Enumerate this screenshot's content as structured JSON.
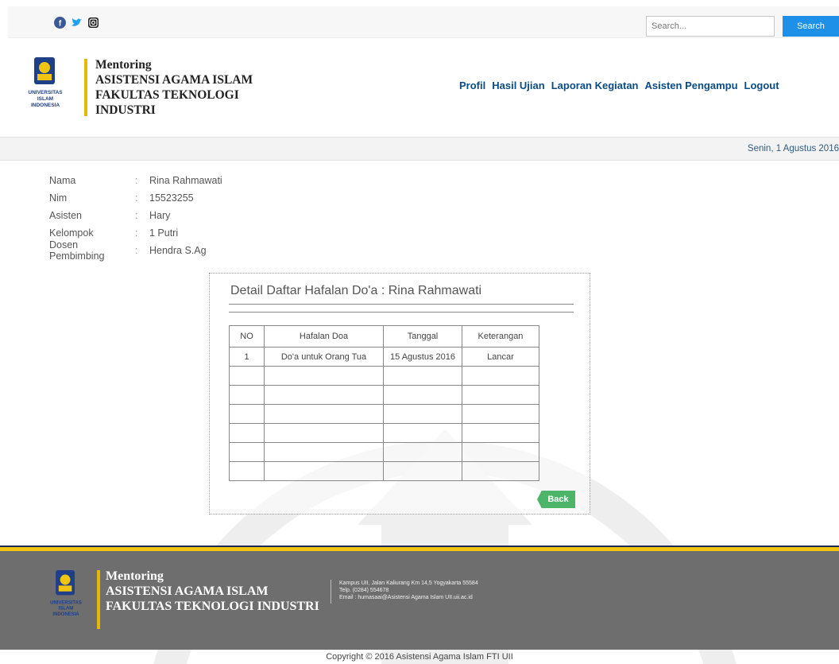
{
  "topbar": {
    "social_icons": [
      "facebook-icon",
      "twitter-icon",
      "instagram-icon"
    ],
    "search_placeholder": "Search...",
    "search_button": "Search"
  },
  "header": {
    "logo_text": [
      "UNIVERSITAS",
      "ISLAM",
      "INDONESIA"
    ],
    "title_line1": "Mentoring",
    "title_line2": "ASISTENSI AGAMA ISLAM",
    "title_line3": "FAKULTAS TEKNOLOGI",
    "title_line4": "INDUSTRI"
  },
  "nav": {
    "profil": "Profil",
    "hasil_ujian": "Hasil Ujian",
    "laporan_kegiatan": "Laporan Kegiatan",
    "asisten_pengampu": "Asisten Pengampu",
    "logout": "Logout"
  },
  "date": "Senin, 1 Agustus 2016",
  "student": {
    "nama_label": "Nama",
    "nama": "Rina Rahmawati",
    "nim_label": "Nim",
    "nim": "15523255",
    "asisten_label": "Asisten",
    "asisten": "Hary",
    "kelompok_label": "Kelompok",
    "kelompok": "1 Putri",
    "dosen_label": "Dosen Pembimbing",
    "dosen": "Hendra S.Ag",
    "separator": ":"
  },
  "panel": {
    "title": "Detail Daftar Hafalan Do'a : Rina Rahmawati",
    "headers": [
      "NO",
      "Hafalan Doa",
      "Tanggal",
      "Keterangan"
    ],
    "rows": [
      [
        "1",
        "Do'a untuk Orang Tua",
        "15 Agustus 2016",
        "Lancar"
      ],
      [
        "",
        "",
        "",
        ""
      ],
      [
        "",
        "",
        "",
        ""
      ],
      [
        "",
        "",
        "",
        ""
      ],
      [
        "",
        "",
        "",
        ""
      ],
      [
        "",
        "",
        "",
        ""
      ],
      [
        "",
        "",
        "",
        ""
      ]
    ],
    "back_button": "Back"
  },
  "footer": {
    "title_line1": "Mentoring",
    "title_line2": "ASISTENSI AGAMA ISLAM",
    "title_line3": "FAKULTAS TEKNOLOGI INDUSTRI",
    "address": "Kampus UII, Jalan Kaliurang Km 14,5 Yogyakarta 55584",
    "phone": "Telp. (0284) 554678",
    "email": "Email : humasaai@Asistensi Agama Islam UII.uii.ac.id",
    "copyright": "Copyright © 2016 Asistensi Agama Islam FTI UII"
  },
  "colors": {
    "search_button": "#1e90e8",
    "nav_link": "#0b4c86",
    "back_button": "#4db56a",
    "footer_bg": "#6e6e6e",
    "accent_yellow": "#f1c40f"
  }
}
